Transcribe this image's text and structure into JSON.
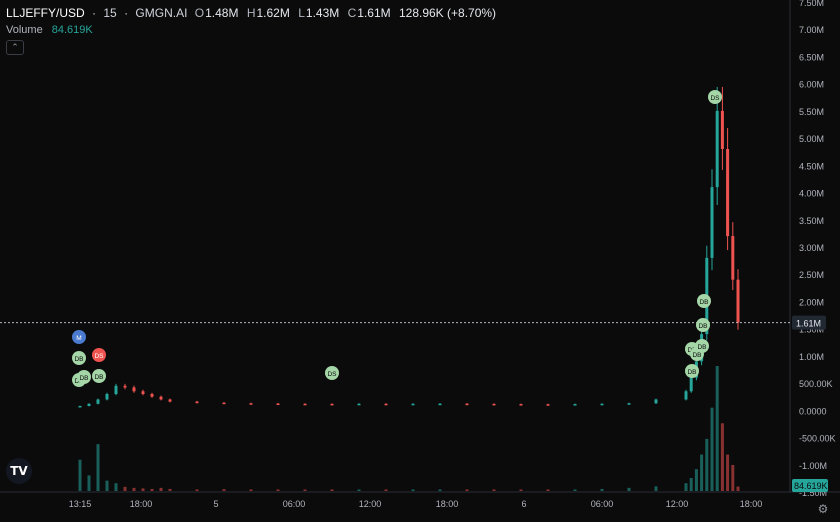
{
  "header": {
    "symbol": "LLJEFFY/USD",
    "sep1": "·",
    "interval": "15",
    "sep2": "·",
    "source": "GMGN.AI",
    "open_label": "O",
    "open": "1.48M",
    "high_label": "H",
    "high": "1.62M",
    "low_label": "L",
    "low": "1.43M",
    "close_label": "C",
    "close": "1.61M",
    "change": "128.96K (+8.70%)"
  },
  "volume": {
    "label": "Volume",
    "value": "84.619K"
  },
  "icons": {
    "collapse": "chevron-up-icon",
    "logo": "tradingview-logo",
    "settings": "gear-icon"
  },
  "colors": {
    "up": "#26a69a",
    "down": "#ef5350",
    "badge_green": "#a5d6a7",
    "badge_red": "#ef5350",
    "badge_blue": "#4a7bd0",
    "price_label_bg": "#222831"
  },
  "price_axis": [
    "7.50M",
    "7.00M",
    "6.50M",
    "6.00M",
    "5.50M",
    "5.00M",
    "4.50M",
    "4.00M",
    "3.50M",
    "3.00M",
    "2.50M",
    "2.00M",
    "1.50M",
    "1.00M",
    "500.00K",
    "0.0000",
    "-500.00K",
    "-1.00M",
    "-1.50M"
  ],
  "time_axis": [
    "13:15",
    "18:00",
    "5",
    "06:00",
    "12:00",
    "18:00",
    "6",
    "06:00",
    "12:00",
    "18:00"
  ],
  "current_price_label": "1.61M",
  "current_volume_label": "84.619K",
  "markers": [
    {
      "text": "M",
      "color": "blue"
    },
    {
      "text": "DS",
      "color": "red"
    },
    {
      "text": "DB",
      "color": "green"
    },
    {
      "text": "DB",
      "color": "green"
    },
    {
      "text": "DB",
      "color": "green"
    },
    {
      "text": "DB",
      "color": "green"
    },
    {
      "text": "DS",
      "color": "green"
    },
    {
      "text": "DB",
      "color": "green"
    },
    {
      "text": "DB",
      "color": "green"
    },
    {
      "text": "DB",
      "color": "green"
    },
    {
      "text": "DB",
      "color": "green"
    },
    {
      "text": "DB",
      "color": "green"
    },
    {
      "text": "DB",
      "color": "green"
    },
    {
      "text": "DS",
      "color": "green"
    }
  ],
  "chart_data": {
    "type": "candlestick",
    "title": "LLJEFFY/USD · 15 · GMGN.AI",
    "x_labels": [
      "13:15",
      "18:00",
      "5",
      "06:00",
      "12:00",
      "18:00",
      "6",
      "06:00",
      "12:00",
      "18:00"
    ],
    "y_unit": "market cap (USD)",
    "ylim": [
      -1500000,
      7500000
    ],
    "series": [
      {
        "name": "price",
        "approx_path": [
          [
            0,
            80000
          ],
          [
            1,
            120000
          ],
          [
            2,
            200000
          ],
          [
            3,
            300000
          ],
          [
            4,
            450000
          ],
          [
            5,
            420000
          ],
          [
            6,
            350000
          ],
          [
            7,
            300000
          ],
          [
            8,
            250000
          ],
          [
            9,
            200000
          ],
          [
            10,
            160000
          ],
          [
            11,
            140000
          ],
          [
            12,
            130000
          ],
          [
            13,
            125000
          ],
          [
            14,
            120000
          ],
          [
            15,
            118000
          ],
          [
            16,
            115000
          ],
          [
            17,
            120000
          ],
          [
            18,
            118000
          ],
          [
            19,
            120000
          ],
          [
            20,
            122000
          ],
          [
            21,
            118000
          ],
          [
            22,
            115000
          ],
          [
            23,
            112000
          ],
          [
            24,
            110000
          ],
          [
            25,
            115000
          ],
          [
            26,
            120000
          ],
          [
            27,
            130000
          ],
          [
            28,
            200000
          ],
          [
            29,
            350000
          ],
          [
            30,
            600000
          ],
          [
            31,
            900000
          ],
          [
            32,
            1400000
          ],
          [
            33,
            2800000
          ],
          [
            34,
            4100000
          ],
          [
            35,
            5500000
          ],
          [
            36,
            4800000
          ],
          [
            37,
            3200000
          ],
          [
            38,
            2400000
          ],
          [
            39,
            1610000
          ]
        ]
      },
      {
        "name": "volume",
        "approx_path": [
          [
            0,
            600
          ],
          [
            1,
            300
          ],
          [
            2,
            900
          ],
          [
            3,
            200
          ],
          [
            4,
            150
          ],
          [
            5,
            80
          ],
          [
            6,
            60
          ],
          [
            7,
            50
          ],
          [
            8,
            40
          ],
          [
            9,
            60
          ],
          [
            10,
            40
          ],
          [
            11,
            30
          ],
          [
            12,
            35
          ],
          [
            13,
            30
          ],
          [
            14,
            30
          ],
          [
            15,
            30
          ],
          [
            16,
            30
          ],
          [
            17,
            30
          ],
          [
            18,
            30
          ],
          [
            19,
            30
          ],
          [
            20,
            30
          ],
          [
            21,
            30
          ],
          [
            22,
            30
          ],
          [
            23,
            30
          ],
          [
            24,
            30
          ],
          [
            25,
            30
          ],
          [
            26,
            40
          ],
          [
            27,
            60
          ],
          [
            28,
            90
          ],
          [
            29,
            150
          ],
          [
            30,
            250
          ],
          [
            31,
            420
          ],
          [
            32,
            700
          ],
          [
            33,
            1000
          ],
          [
            34,
            1600
          ],
          [
            35,
            2400
          ],
          [
            36,
            1300
          ],
          [
            37,
            700
          ],
          [
            38,
            500
          ],
          [
            39,
            85
          ]
        ]
      }
    ]
  }
}
